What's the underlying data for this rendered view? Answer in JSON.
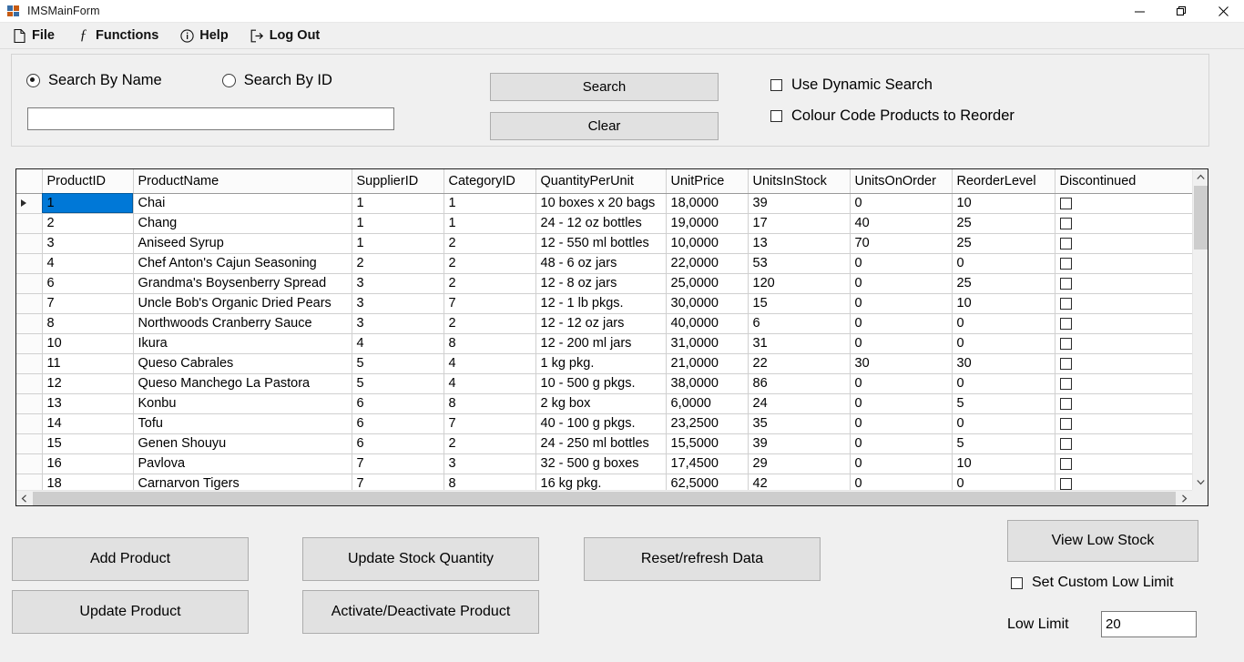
{
  "window": {
    "title": "IMSMainForm",
    "icon": "app-icon",
    "controls": {
      "minimize": "minimize-icon",
      "restore": "restore-icon",
      "close": "close-icon"
    }
  },
  "menubar": {
    "items": [
      {
        "label": "File",
        "icon": "document-icon"
      },
      {
        "label": "Functions",
        "icon": "function-icon"
      },
      {
        "label": "Help",
        "icon": "info-circle-icon"
      },
      {
        "label": "Log Out",
        "icon": "logout-icon"
      }
    ]
  },
  "search": {
    "radios": [
      {
        "label": "Search By Name",
        "checked": true
      },
      {
        "label": "Search By ID",
        "checked": false
      }
    ],
    "input_value": "",
    "input_placeholder": "",
    "buttons": {
      "search": "Search",
      "clear": "Clear"
    },
    "checkboxes": [
      {
        "label": "Use Dynamic Search",
        "checked": false
      },
      {
        "label": "Colour Code Products to Reorder",
        "checked": false
      }
    ]
  },
  "grid": {
    "columns": [
      "ProductID",
      "ProductName",
      "SupplierID",
      "CategoryID",
      "QuantityPerUnit",
      "UnitPrice",
      "UnitsInStock",
      "UnitsOnOrder",
      "ReorderLevel",
      "Discontinued"
    ],
    "selected_row": 0,
    "rows": [
      [
        "1",
        "Chai",
        "1",
        "1",
        "10 boxes x 20 bags",
        "18,0000",
        "39",
        "0",
        "10",
        false
      ],
      [
        "2",
        "Chang",
        "1",
        "1",
        "24 - 12 oz bottles",
        "19,0000",
        "17",
        "40",
        "25",
        false
      ],
      [
        "3",
        "Aniseed Syrup",
        "1",
        "2",
        "12 - 550 ml bottles",
        "10,0000",
        "13",
        "70",
        "25",
        false
      ],
      [
        "4",
        "Chef Anton's Cajun Seasoning",
        "2",
        "2",
        "48 - 6 oz jars",
        "22,0000",
        "53",
        "0",
        "0",
        false
      ],
      [
        "6",
        "Grandma's Boysenberry Spread",
        "3",
        "2",
        "12 - 8 oz jars",
        "25,0000",
        "120",
        "0",
        "25",
        false
      ],
      [
        "7",
        "Uncle Bob's Organic Dried Pears",
        "3",
        "7",
        "12 - 1 lb pkgs.",
        "30,0000",
        "15",
        "0",
        "10",
        false
      ],
      [
        "8",
        "Northwoods Cranberry Sauce",
        "3",
        "2",
        "12 - 12 oz jars",
        "40,0000",
        "6",
        "0",
        "0",
        false
      ],
      [
        "10",
        "Ikura",
        "4",
        "8",
        "12 - 200 ml jars",
        "31,0000",
        "31",
        "0",
        "0",
        false
      ],
      [
        "11",
        "Queso Cabrales",
        "5",
        "4",
        "1 kg pkg.",
        "21,0000",
        "22",
        "30",
        "30",
        false
      ],
      [
        "12",
        "Queso Manchego La Pastora",
        "5",
        "4",
        "10 - 500 g pkgs.",
        "38,0000",
        "86",
        "0",
        "0",
        false
      ],
      [
        "13",
        "Konbu",
        "6",
        "8",
        "2 kg box",
        "6,0000",
        "24",
        "0",
        "5",
        false
      ],
      [
        "14",
        "Tofu",
        "6",
        "7",
        "40 - 100 g pkgs.",
        "23,2500",
        "35",
        "0",
        "0",
        false
      ],
      [
        "15",
        "Genen Shouyu",
        "6",
        "2",
        "24 - 250 ml bottles",
        "15,5000",
        "39",
        "0",
        "5",
        false
      ],
      [
        "16",
        "Pavlova",
        "7",
        "3",
        "32 - 500 g boxes",
        "17,4500",
        "29",
        "0",
        "10",
        false
      ],
      [
        "18",
        "Carnarvon Tigers",
        "7",
        "8",
        "16 kg pkg.",
        "62,5000",
        "42",
        "0",
        "0",
        false
      ]
    ]
  },
  "actions": {
    "add_product": "Add Product",
    "update_product": "Update Product",
    "update_stock": "Update Stock Quantity",
    "activate_deactivate": "Activate/Deactivate Product",
    "reset_refresh": "Reset/refresh Data",
    "view_low_stock": "View Low Stock"
  },
  "low_limit": {
    "checkbox_label": "Set Custom Low Limit",
    "checkbox_checked": false,
    "field_label": "Low Limit",
    "value": "20"
  },
  "colors": {
    "selection_blue": "#0078d7",
    "window_background": "#f0f0f0",
    "button_face": "#e1e1e1",
    "grid_background": "#ffffff"
  }
}
